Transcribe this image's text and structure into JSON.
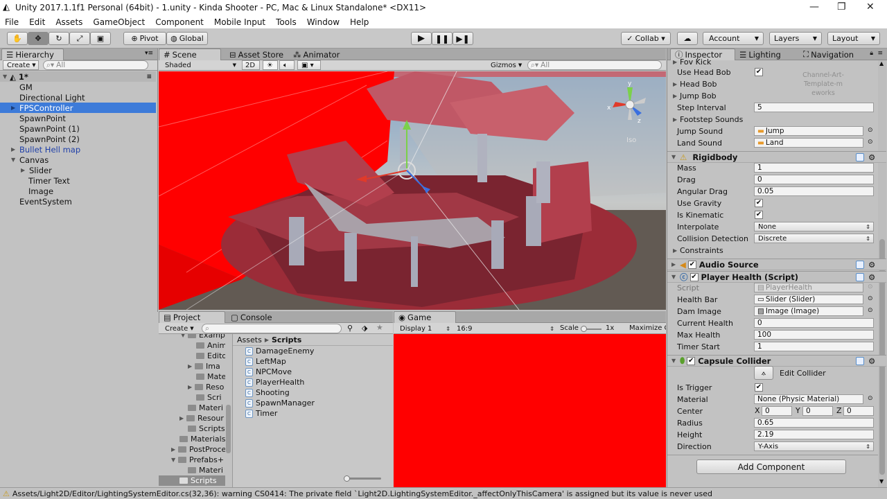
{
  "window": {
    "title": "Unity 2017.1.1f1 Personal (64bit) - 1.unity - Kinda Shooter - PC, Mac & Linux Standalone* <DX11>"
  },
  "menu": [
    "File",
    "Edit",
    "Assets",
    "GameObject",
    "Component",
    "Mobile Input",
    "Tools",
    "Window",
    "Help"
  ],
  "toolbar": {
    "pivot": "Pivot",
    "global": "Global",
    "collab": "Collab ▾",
    "account": "Account",
    "layers": "Layers",
    "layout": "Layout"
  },
  "hierarchy": {
    "tab": "Hierarchy",
    "create": "Create",
    "search_placeholder": "All",
    "scene": "1*",
    "items": [
      "GM",
      "Directional Light",
      "FPSController",
      "SpawnPoint",
      "SpawnPoint (1)",
      "SpawnPoint (2)",
      "Bullet Hell map",
      "Canvas",
      "Slider",
      "Timer Text",
      "Image",
      "EventSystem"
    ]
  },
  "scene": {
    "tabs": [
      "Scene",
      "Asset Store",
      "Animator"
    ],
    "shading": "Shaded",
    "mode2d": "2D",
    "gizmos": "Gizmos",
    "search_placeholder": "All",
    "persp_label": "Iso"
  },
  "project": {
    "tabs": [
      "Project",
      "Console"
    ],
    "create": "Create",
    "tree": [
      "Examp",
      "Anim",
      "Edito",
      "Ima",
      "Mate",
      "Reso",
      "Scri",
      "Materi",
      "Resour",
      "Scripts",
      "Materials",
      "PostProce",
      "Prefabs+",
      "Materi",
      "Scripts"
    ],
    "breadcrumb": [
      "Assets",
      "Scripts"
    ],
    "files": [
      "DamageEnemy",
      "LeftMap",
      "NPCMove",
      "PlayerHealth",
      "Shooting",
      "SpawnManager",
      "Timer"
    ]
  },
  "game": {
    "tab": "Game",
    "display": "Display 1",
    "aspect": "16:9",
    "scale_label": "Scale",
    "scale_value": "1x",
    "maximize": "Maximize C"
  },
  "inspector": {
    "tabs": [
      "Inspector",
      "Lighting",
      "Navigation"
    ],
    "watermark": [
      "Channel-Art-",
      "Template-m",
      "eworks"
    ],
    "fov": "Fov Kick",
    "fps_rows": [
      {
        "label": "Use Head Bob",
        "type": "check"
      },
      {
        "label": "Head Bob",
        "type": "fold"
      },
      {
        "label": "Jump Bob",
        "type": "fold"
      },
      {
        "label": "Step Interval",
        "value": "5"
      },
      {
        "label": "Footstep Sounds",
        "type": "fold"
      },
      {
        "label": "Jump Sound",
        "value": "Jump"
      },
      {
        "label": "Land Sound",
        "value": "Land"
      }
    ],
    "rigidbody": {
      "title": "Rigidbody",
      "mass": "1",
      "drag": "0",
      "angular_drag": "0.05",
      "interpolate": "None",
      "collision": "Discrete",
      "labels": [
        "Mass",
        "Drag",
        "Angular Drag",
        "Use Gravity",
        "Is Kinematic",
        "Interpolate",
        "Collision Detection",
        "Constraints"
      ]
    },
    "audio": {
      "title": "Audio Source"
    },
    "health": {
      "title": "Player Health (Script)",
      "script": "PlayerHealth",
      "health_bar": "Slider (Slider)",
      "dam_image": "Image (Image)",
      "current": "0",
      "max": "100",
      "timer_start": "1",
      "labels": [
        "Script",
        "Health Bar",
        "Dam Image",
        "Current Health",
        "Max Health",
        "Timer Start"
      ]
    },
    "capsule": {
      "title": "Capsule Collider",
      "edit": "Edit Collider",
      "material": "None (Physic Material)",
      "cx": "0",
      "cy": "0",
      "cz": "0",
      "radius": "0.65",
      "height": "2.19",
      "direction": "Y-Axis",
      "labels": [
        "Is Trigger",
        "Material",
        "Center",
        "Radius",
        "Height",
        "Direction"
      ]
    },
    "add_component": "Add Component"
  },
  "status": "Assets/Light2D/Editor/LightingSystemEditor.cs(32,36): warning CS0414: The private field `Light2D.LightingSystemEditor._affectOnlyThisCamera' is assigned but its value is never used",
  "colors": {
    "selection": "#3d7bd9",
    "red": "#ff0000",
    "panel": "#c2c2c2"
  }
}
